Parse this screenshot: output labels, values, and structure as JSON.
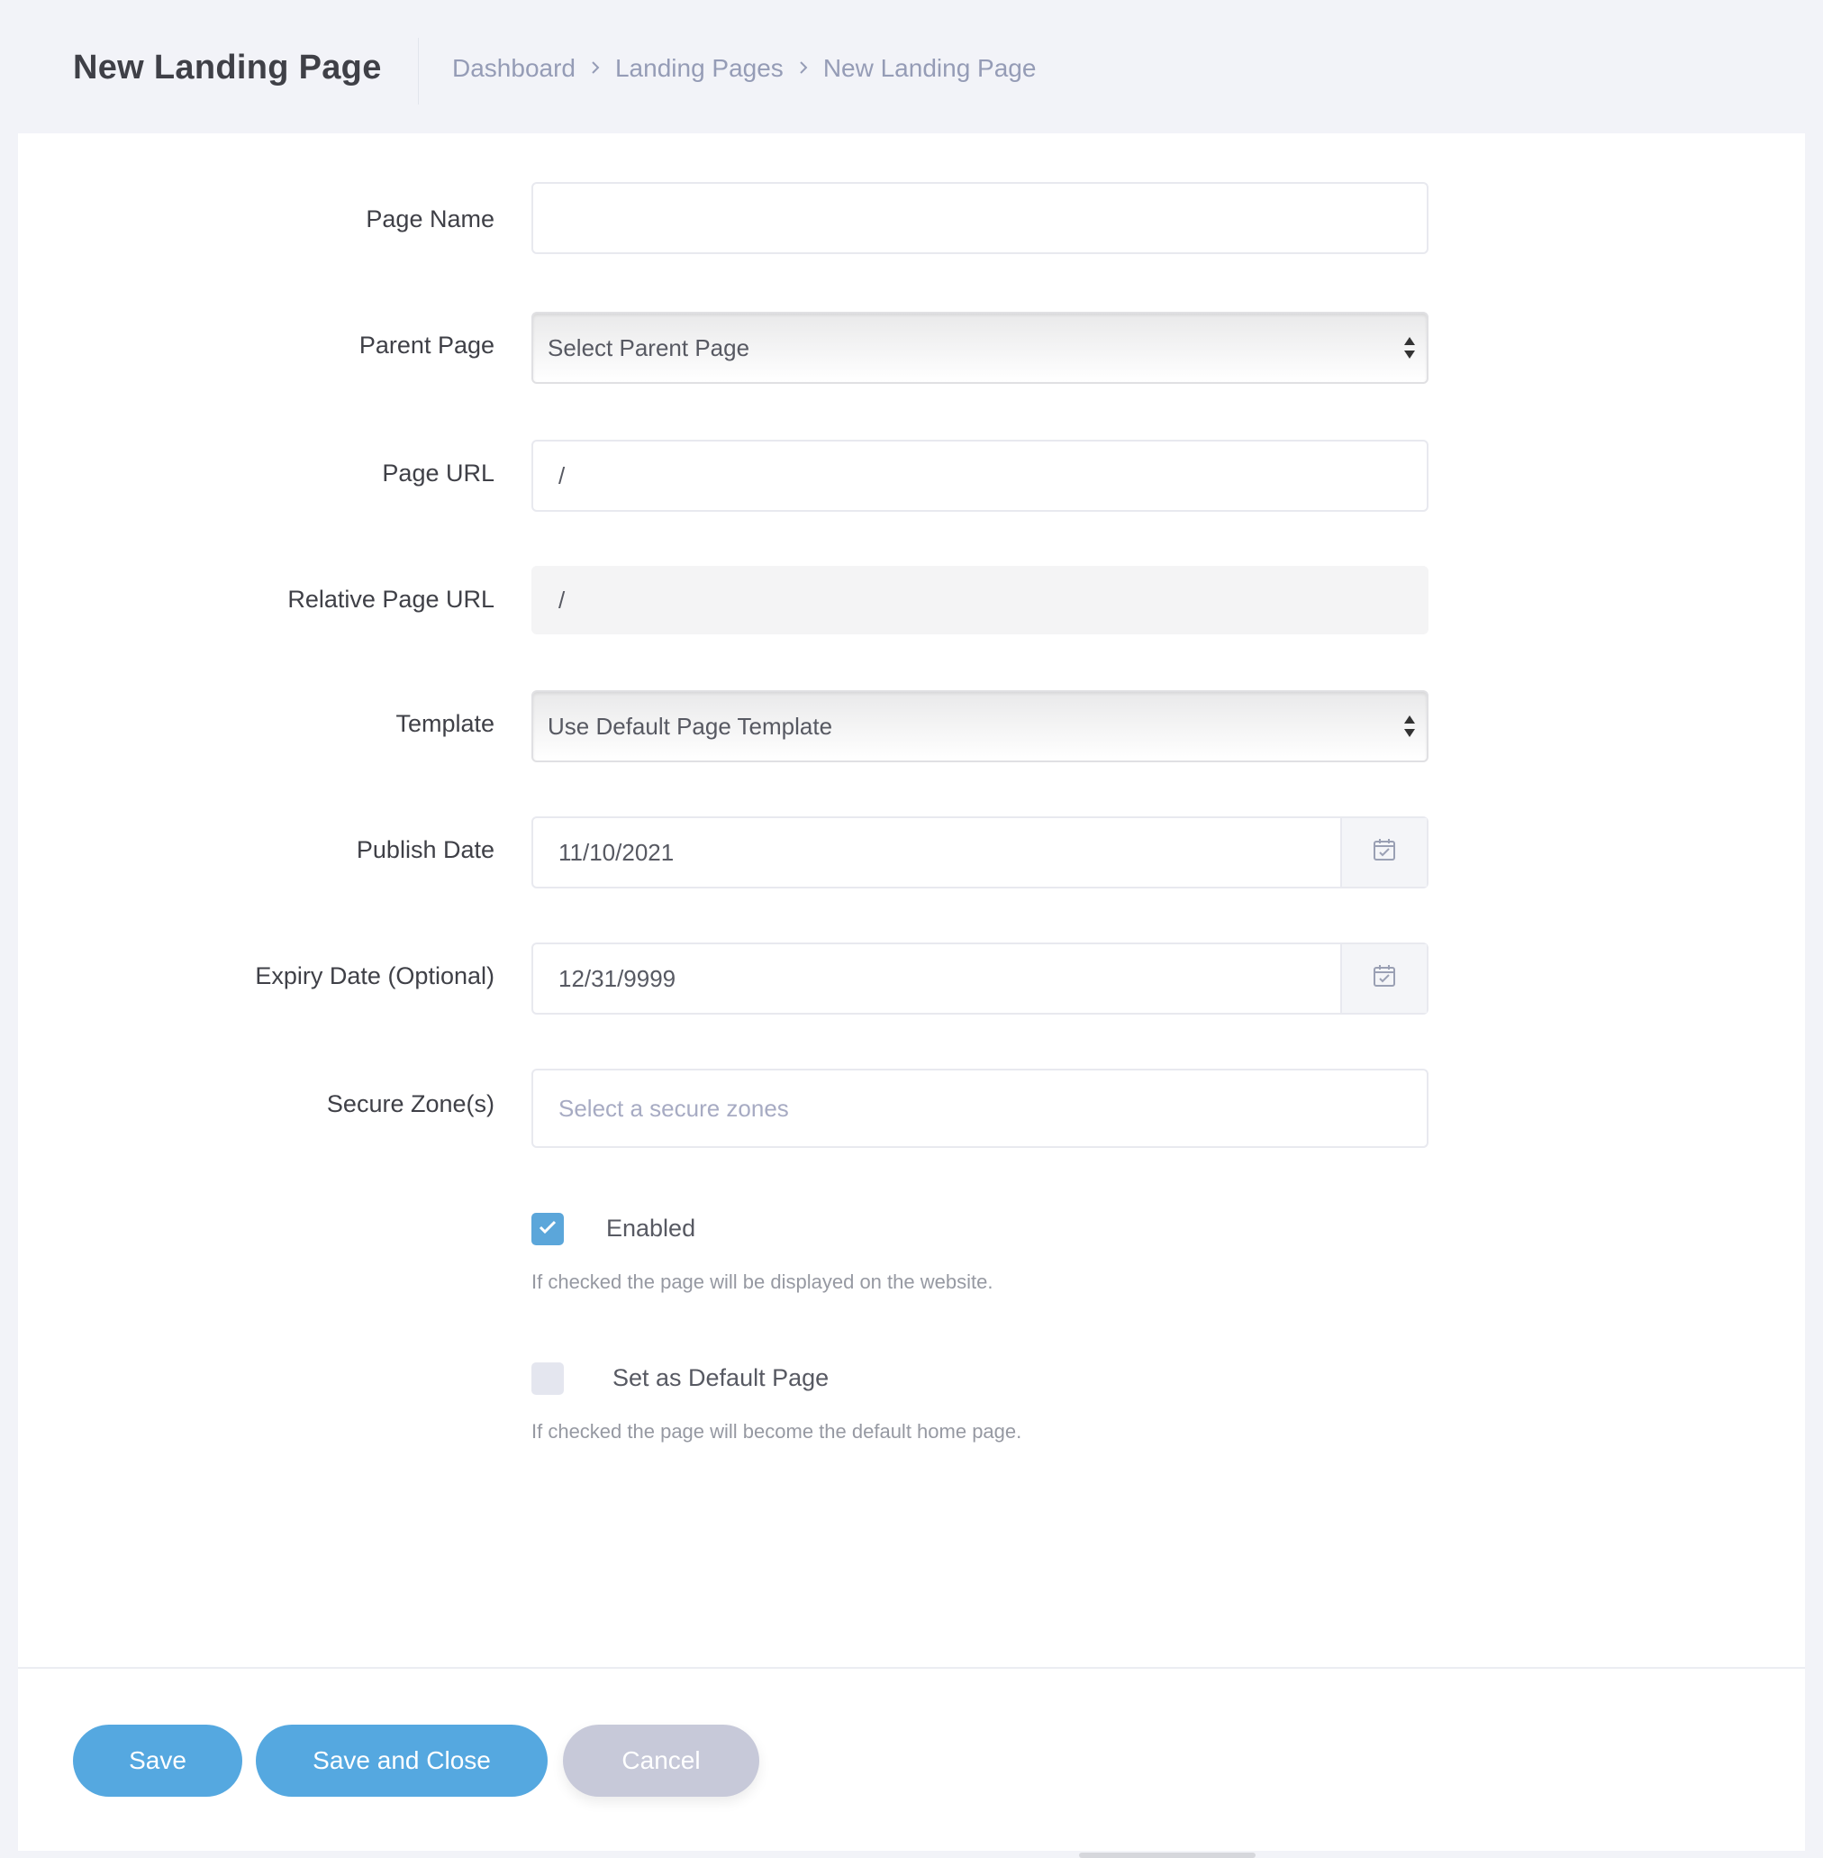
{
  "header": {
    "title": "New Landing Page",
    "breadcrumb": [
      "Dashboard",
      "Landing Pages",
      "New Landing Page"
    ],
    "separator": ">"
  },
  "form": {
    "page_name": {
      "label": "Page Name",
      "value": ""
    },
    "parent_page": {
      "label": "Parent Page",
      "value": "Select Parent Page"
    },
    "page_url": {
      "label": "Page URL",
      "value": "/"
    },
    "relative_page_url": {
      "label": "Relative Page URL",
      "value": "/"
    },
    "template": {
      "label": "Template",
      "value": "Use Default Page Template"
    },
    "publish_date": {
      "label": "Publish Date",
      "value": "11/10/2021"
    },
    "expiry_date": {
      "label": "Expiry Date (Optional)",
      "value": "12/31/9999"
    },
    "secure_zones": {
      "label": "Secure Zone(s)",
      "placeholder": "Select a secure zones"
    },
    "enabled": {
      "label": "Enabled",
      "checked": true,
      "help": "If checked the page will be displayed on the website."
    },
    "default_page": {
      "label": "Set as Default Page",
      "checked": false,
      "help": "If checked the page will become the default home page."
    }
  },
  "actions": {
    "save": "Save",
    "save_close": "Save and Close",
    "cancel": "Cancel"
  },
  "colors": {
    "primary": "#55a8e0",
    "checkbox_checked": "#5ba6da",
    "cancel": "#c7c9d9",
    "background": "#f2f3f8"
  }
}
